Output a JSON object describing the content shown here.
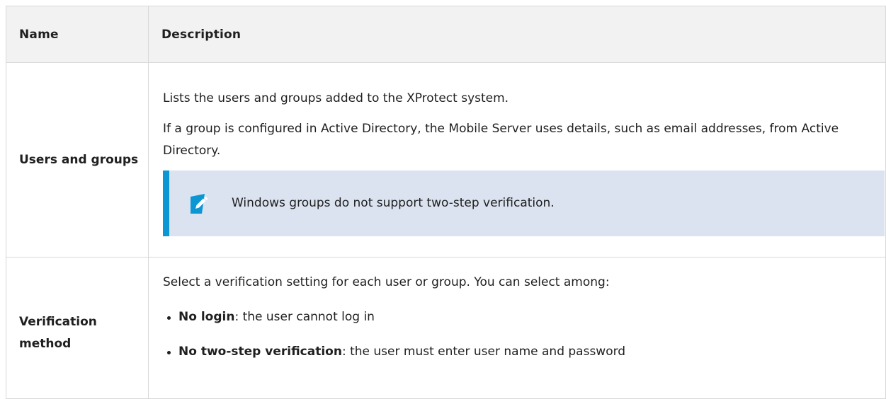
{
  "table": {
    "headers": {
      "name": "Name",
      "description": "Description"
    },
    "rows": [
      {
        "name": "Users and groups",
        "paragraphs": [
          "Lists the users and groups added to the XProtect system.",
          "If a group is configured in Active Directory, the Mobile Server uses details, such as email addresses, from Active Directory."
        ],
        "note": {
          "icon": "pencil-note-icon",
          "text": "Windows groups do not support two-step verification."
        }
      },
      {
        "name": "Verification method",
        "intro": "Select a verification setting for each user or group. You can select among:",
        "options": [
          {
            "term": "No login",
            "desc": ": the user cannot log in"
          },
          {
            "term": "No two-step verification",
            "desc": ": the user must enter user name and password"
          }
        ]
      }
    ]
  },
  "colors": {
    "header_bg": "#f2f2f2",
    "note_bg": "#dbe3f0",
    "note_accent": "#0c97d4",
    "border": "#d8d8d8"
  }
}
